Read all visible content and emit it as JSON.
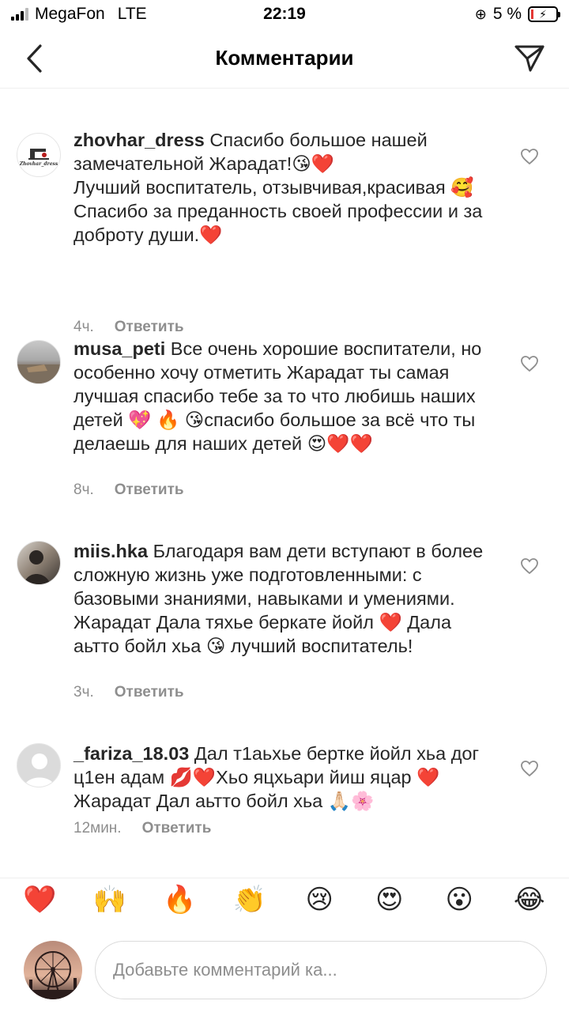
{
  "status": {
    "carrier": "MegaFon",
    "network": "LTE",
    "time": "22:19",
    "battery": "5 %"
  },
  "header": {
    "title": "Комментарии",
    "back_icon": "chevron-left-icon",
    "send_icon": "paper-plane-icon"
  },
  "comments": [
    {
      "username": "zhovhar_dress",
      "lines": [
        "Спасибо большое нашей замечательной Жарадат!😘❤️",
        "Лучший воспитатель, отзывчивая,красивая 🥰",
        "Спасибо за преданность своей профессии и за доброту души.❤️"
      ],
      "time": "4ч.",
      "reply": "Ответить",
      "avatar_text": "Zhovhar_dress"
    },
    {
      "username": "musa_peti",
      "lines": [
        "Все очень хорошие воспитатели, но особенно хочу отметить Жарадат ты самая лучшая спасибо тебе за то что любишь наших детей 💖 🔥 😘спасибо большое за всё что ты делаешь для наших детей 😍❤️❤️"
      ],
      "time": "8ч.",
      "reply": "Ответить"
    },
    {
      "username": "miis.hka",
      "lines": [
        "Благодаря вам дети вступают в более сложную жизнь уже подготовленными: с базовыми знаниями, навыками и умениями.  Жарадат  Дала тяхье беркате  йойл ❤️ Дала аьтто бойл хьа 😘 лучший воспитатель!"
      ],
      "time": "3ч.",
      "reply": "Ответить"
    },
    {
      "username": "_fariza_18.03",
      "lines": [
        "Дал т1аьхье бертке йойл хьа дог ц1ен адам 💋❤️Хьо яцхьари йиш яцар ❤️Жарадат Дал аьтто бойл хьа 🙏🏻🌸"
      ],
      "time": "12мин.",
      "reply": "Ответить"
    }
  ],
  "emoji_bar": [
    "❤️",
    "🙌",
    "🔥",
    "👏",
    "😢",
    "😍",
    "😮",
    "😂"
  ],
  "input": {
    "placeholder": "Добавьте комментарий ка..."
  }
}
